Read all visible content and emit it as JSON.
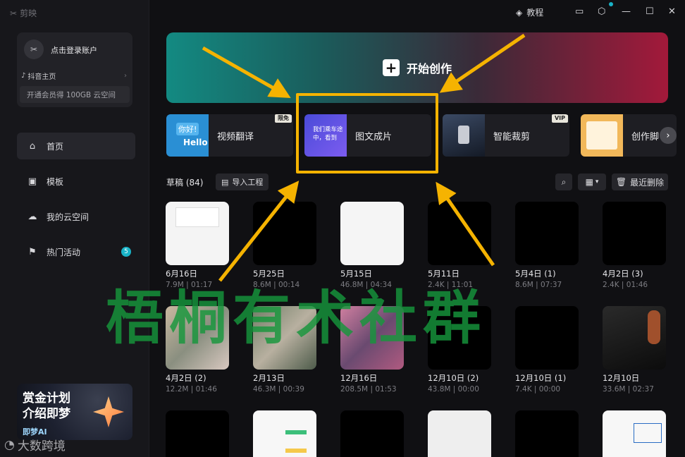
{
  "app": {
    "logo_text": "剪映"
  },
  "account": {
    "login_text": "点击登录账户",
    "douyin_label": "抖音主页",
    "member_text": "开通会员得 100GB 云空间"
  },
  "nav": {
    "items": [
      {
        "label": "首页",
        "icon": "home-icon"
      },
      {
        "label": "模板",
        "icon": "template-icon"
      },
      {
        "label": "我的云空间",
        "icon": "cloud-icon"
      },
      {
        "label": "热门活动",
        "icon": "flag-icon",
        "badge": "5"
      }
    ]
  },
  "promo": {
    "line1": "赏金计划",
    "line2": "介绍即梦",
    "brand": "即梦AI"
  },
  "watermark_bottom": "大数跨境",
  "titlebar": {
    "tutorial_label": "教程"
  },
  "hero": {
    "label": "开始创作"
  },
  "features": [
    {
      "label": "视频翻译",
      "tag": "限免",
      "thumb_text": "你好! Hello"
    },
    {
      "label": "图文成片",
      "thumb_text": "我们乘车途中，看到"
    },
    {
      "label": "智能裁剪",
      "tag": "VIP"
    },
    {
      "label": "创作脚"
    }
  ],
  "drafts": {
    "title": "草稿 (84)",
    "import_label": "导入工程",
    "recent_delete_label": "最近删除",
    "items": [
      {
        "name": "6月16日",
        "meta": "7.9M | 01:17"
      },
      {
        "name": "5月25日",
        "meta": "8.6M | 00:14"
      },
      {
        "name": "5月15日",
        "meta": "46.8M | 04:34"
      },
      {
        "name": "5月11日",
        "meta": "2.4K | 11:01"
      },
      {
        "name": "5月4日 (1)",
        "meta": "8.6M | 07:37"
      },
      {
        "name": "4月2日 (3)",
        "meta": "2.4K | 01:46"
      },
      {
        "name": "4月2日 (2)",
        "meta": "12.2M | 01:46"
      },
      {
        "name": "2月13日",
        "meta": "46.3M | 00:39"
      },
      {
        "name": "12月16日",
        "meta": "208.5M | 01:53"
      },
      {
        "name": "12月10日 (2)",
        "meta": "43.8M | 00:00"
      },
      {
        "name": "12月10日 (1)",
        "meta": "7.4K | 00:00"
      },
      {
        "name": "12月10日",
        "meta": "33.6M | 02:37"
      }
    ]
  },
  "overlay_watermark": "梧桐有术社群",
  "colors": {
    "accent": "#19b3c7",
    "highlight": "#f5b301",
    "watermark": "#16963c"
  }
}
